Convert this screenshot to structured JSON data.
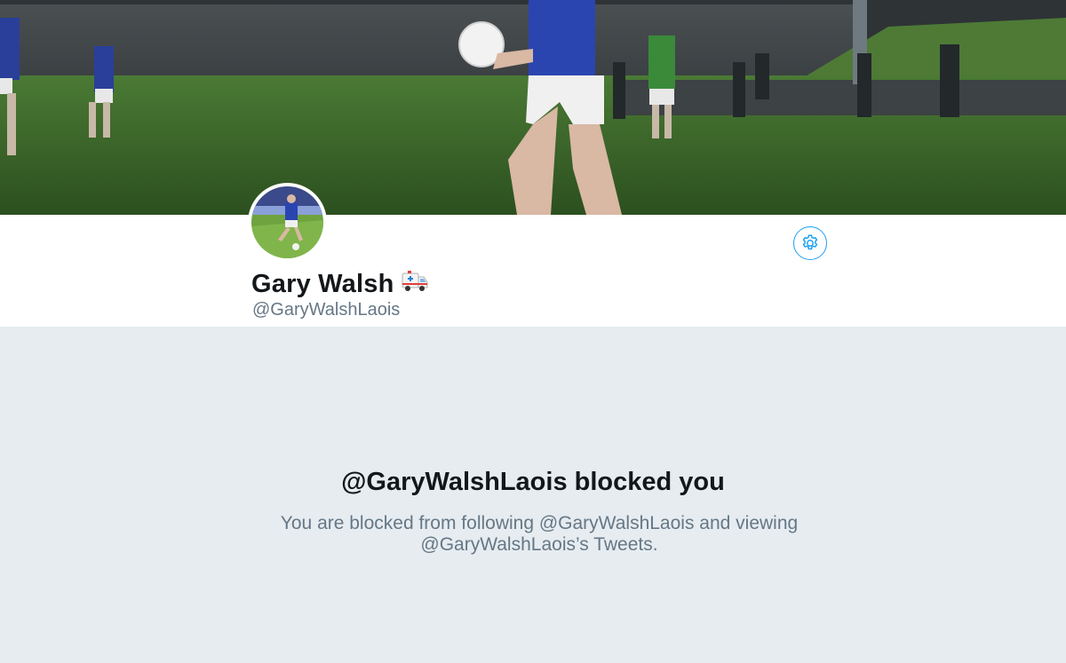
{
  "profile": {
    "display_name": "Gary Walsh",
    "name_emoji": "ambulance-emoji",
    "handle": "@GaryWalshLaois"
  },
  "blocked": {
    "title": "@GaryWalshLaois blocked you",
    "description": "You are blocked from following @GaryWalshLaois and viewing @GaryWalshLaois’s Tweets."
  },
  "colors": {
    "accent": "#1da1f2",
    "background": "#e6ecf0",
    "text_primary": "#14171a",
    "text_secondary": "#657786"
  },
  "icons": {
    "settings": "gear-icon"
  }
}
